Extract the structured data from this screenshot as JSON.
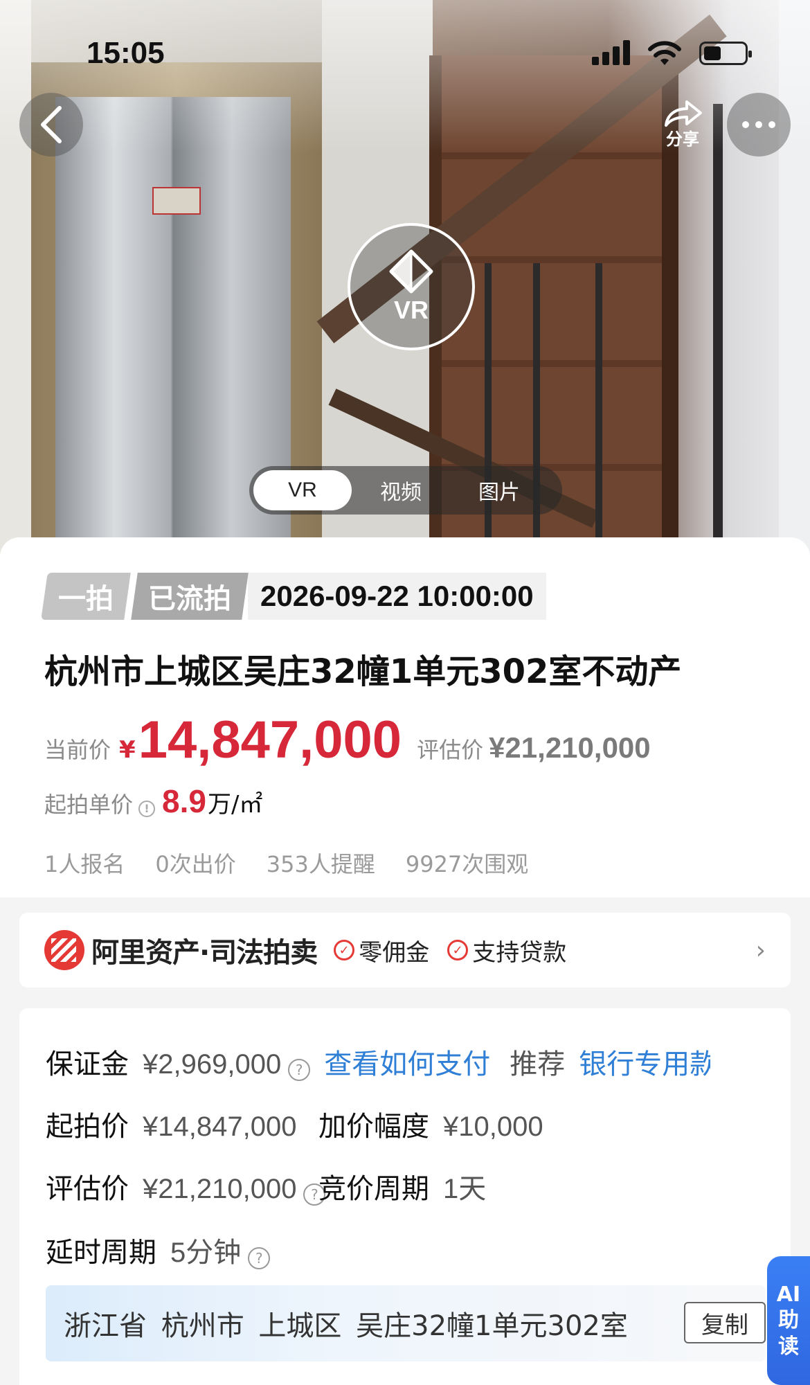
{
  "status": {
    "time": "15:05"
  },
  "header": {
    "share_label": "分享"
  },
  "media": {
    "vr_label": "VR",
    "tabs": [
      {
        "label": "VR",
        "active": true
      },
      {
        "label": "视频",
        "active": false
      },
      {
        "label": "图片",
        "active": false
      }
    ]
  },
  "auction": {
    "round": "一拍",
    "status": "已流拍",
    "datetime": "2026-09-22 10:00:00",
    "title": "杭州市上城区吴庄32幢1单元302室不动产",
    "current_price_label": "当前价",
    "currency": "¥",
    "current_price": "14,847,000",
    "eval_label": "评估价",
    "eval_price": "¥21,210,000",
    "unit_price_label": "起拍单价",
    "unit_price": "8.9",
    "unit_suffix": "万/㎡",
    "stats": [
      "1人报名",
      "0次出价",
      "353人提醒",
      "9927次围观"
    ]
  },
  "platform": {
    "name": "阿里资产·司法拍卖",
    "features": [
      "零佣金",
      "支持贷款"
    ]
  },
  "details": {
    "deposit_label": "保证金",
    "deposit_value": "¥2,969,000",
    "pay_link": "查看如何支付",
    "recommend_label": "推荐",
    "recommend_link": "银行专用款",
    "start_price_label": "起拍价",
    "start_price_value": "¥14,847,000",
    "increment_label": "加价幅度",
    "increment_value": "¥10,000",
    "eval_label": "评估价",
    "eval_value": "¥21,210,000",
    "cycle_label": "竞价周期",
    "cycle_value": "1天",
    "delay_label": "延时周期",
    "delay_value": "5分钟",
    "address": "浙江省 杭州市 上城区 吴庄32幢1单元302室",
    "copy_label": "复制"
  },
  "ai_button": {
    "line1": "AI",
    "line2": "助",
    "line3": "读"
  },
  "colors": {
    "price_red": "#d62839",
    "link_blue": "#2f7fd6",
    "ai_blue": "#3b7ff5"
  }
}
